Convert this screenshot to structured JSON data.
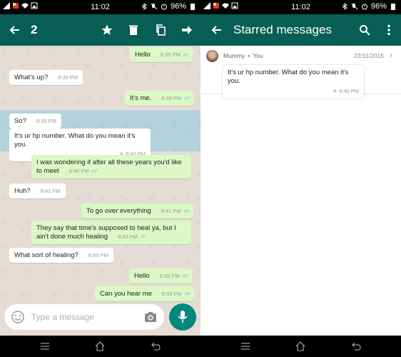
{
  "status": {
    "time": "11:02",
    "battery": "96%"
  },
  "chat_screen": {
    "selected_count": "2",
    "actions": [
      "star-icon",
      "delete-icon",
      "copy-icon",
      "forward-icon"
    ],
    "messages": [
      {
        "text": "Hello",
        "time": "8:39 PM",
        "dir": "out",
        "ticks": "✓✓"
      },
      {
        "text": "What's up?",
        "time": "8:39 PM",
        "dir": "in"
      },
      {
        "text": "It's me.",
        "time": "8:39 PM",
        "dir": "out",
        "ticks": "✓✓"
      },
      {
        "text": "So?",
        "time": "8:39 PM",
        "dir": "in"
      },
      {
        "text": "It's ur hp number. What do you mean it's you.",
        "time": "8:40 PM",
        "dir": "in",
        "starred": true
      },
      {
        "text": "I was wondering if after all these years you'd like to meet",
        "time": "8:40 PM",
        "dir": "out",
        "ticks": "✓✓"
      },
      {
        "text": "Huh?",
        "time": "8:41 PM",
        "dir": "in"
      },
      {
        "text": "To go over everything",
        "time": "8:41 PM",
        "dir": "out",
        "ticks": "✓✓"
      },
      {
        "text": "They say that time's supposed to heal ya, but I ain't done much healing",
        "time": "8:53 PM",
        "dir": "out",
        "ticks": "✓✓"
      },
      {
        "text": "What sort of healing?",
        "time": "8:55 PM",
        "dir": "in"
      },
      {
        "text": "Hello",
        "time": "8:55 PM",
        "dir": "out",
        "ticks": "✓✓"
      },
      {
        "text": "Can you hear me",
        "time": "8:55 PM",
        "dir": "out",
        "ticks": "✓✓"
      }
    ],
    "input_placeholder": "Type a message"
  },
  "starred_screen": {
    "title": "Starred messages",
    "item": {
      "sender": "Mummy",
      "recipient": "You",
      "separator": "•",
      "date": "22/11/2015",
      "text": "It's ur hp number. What do you mean it's you.",
      "time": "8:40 PM"
    }
  },
  "colors": {
    "appbar": "#075e54",
    "outgoing": "#dcf8c6",
    "incoming": "#ffffff",
    "fab": "#00897b",
    "selection": "#34b7f1"
  }
}
